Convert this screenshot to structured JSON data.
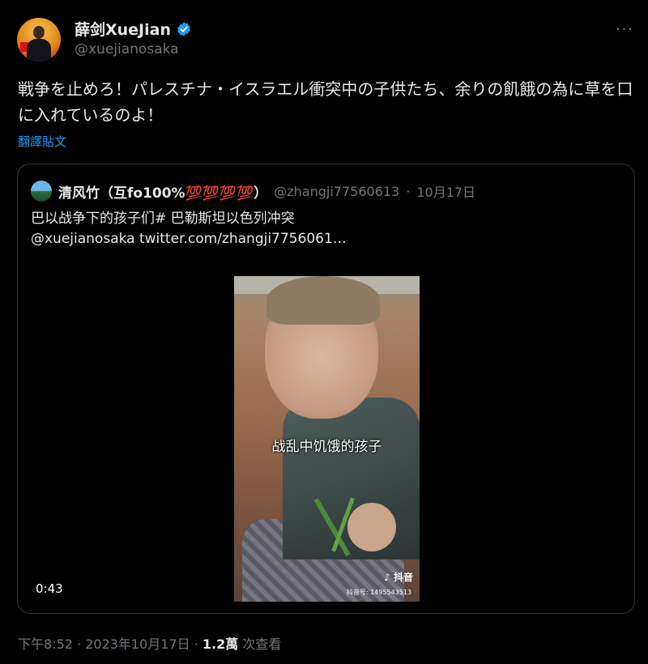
{
  "tweet": {
    "author": {
      "display_name": "薛剑XueJian",
      "handle": "@xuejianosaka"
    },
    "more_label": "···",
    "text": "戦争を止めろ！パレスチナ・イスラエル衝突中の子供たち、余りの飢餓の為に草を口に入れているのよ！",
    "translate_label": "翻譯貼文"
  },
  "quoted": {
    "display_name": "清风竹（互fo100%💯💯💯💯）",
    "handle": "@zhangji77560613",
    "separator": "·",
    "date": "10月17日",
    "line1": "巴以战争下的孩子们# 巴勒斯坦以色列冲突",
    "line2": "@xuejianosaka  twitter.com/zhangji7756061…",
    "video": {
      "caption": "战乱中饥饿的孩子",
      "duration": "0:43",
      "logo": "♪ 抖音",
      "watermark_id": "抖音号: 1495543513"
    }
  },
  "footer": {
    "time": "下午8:52",
    "sep1": " · ",
    "date": "2023年10月17日",
    "sep2": " · ",
    "views": "1.2萬",
    "views_label": " 次查看"
  },
  "colors": {
    "background": "#000000",
    "text": "#e7e9ea",
    "secondary": "#71767b",
    "link": "#1d9bf0",
    "verified": "#1d9bf0"
  }
}
